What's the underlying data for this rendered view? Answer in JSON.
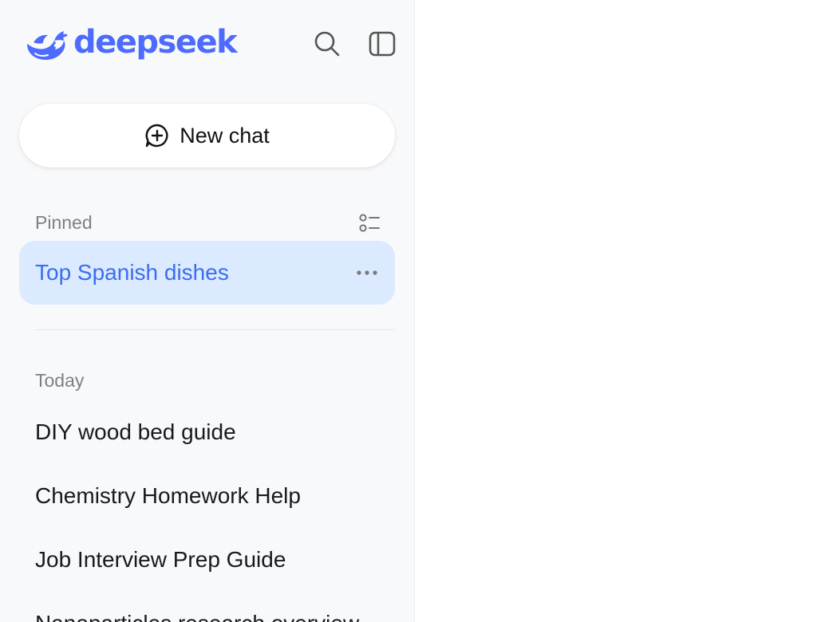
{
  "brand": {
    "name": "deepseek",
    "color": "#4d6bfe",
    "logo_icon": "whale-logo-icon"
  },
  "header": {
    "search_icon": "search-icon",
    "toggle_icon": "sidebar-toggle-icon"
  },
  "new_chat": {
    "label": "New chat",
    "icon": "chat-plus-icon"
  },
  "pinned": {
    "label": "Pinned",
    "manage_icon": "list-manage-icon",
    "items": [
      {
        "label": "Top Spanish dishes",
        "selected": true,
        "more_icon": "more-horizontal-icon"
      }
    ]
  },
  "today": {
    "label": "Today",
    "items": [
      {
        "label": "DIY wood bed guide"
      },
      {
        "label": "Chemistry Homework Help"
      },
      {
        "label": "Job Interview Prep Guide"
      },
      {
        "label": "Nanoparticles research overview"
      }
    ]
  },
  "colors": {
    "sidebar_bg": "#f8f9fb",
    "selected_bg": "#dbeafe",
    "selected_text": "#3b6ef0",
    "section_label": "#808080"
  }
}
